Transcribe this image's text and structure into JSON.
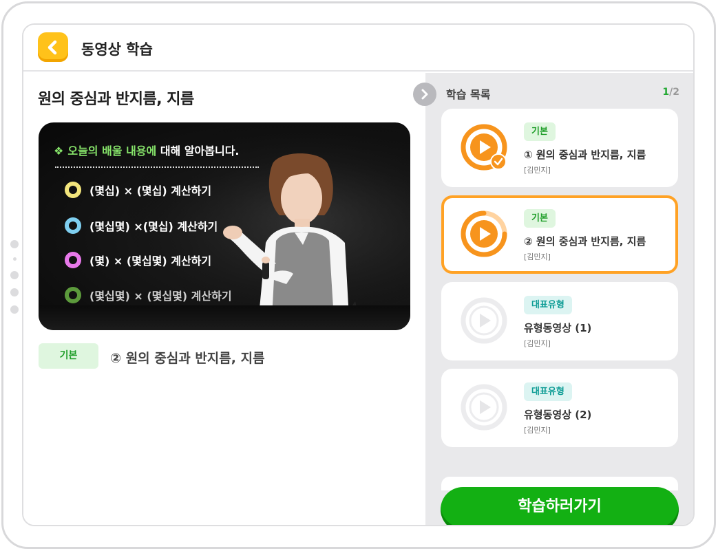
{
  "header": {
    "title": "동영상 학습"
  },
  "lesson": {
    "title": "원의 중심과 반지름, 지름"
  },
  "video": {
    "heading_prefix": "오늘의 배울 내용에",
    "heading_suffix": " 대해 알아봅니다.",
    "items": [
      {
        "text": "(몇십) ×  (몇십) 계산하기",
        "ring_color": "#f3e57c"
      },
      {
        "text": "(몇십몇) ×(몇십) 계산하기",
        "ring_color": "#7fcff0"
      },
      {
        "text": "(몇) × (몇십몇) 계산하기",
        "ring_color": "#e879ea"
      },
      {
        "text": "(몇십몇) × (몇십몇) 계산하기",
        "ring_color": "#5c9a3c"
      }
    ]
  },
  "current": {
    "tag": "기본",
    "title": "② 원의 중심과 반지름, 지름"
  },
  "sidebar": {
    "title": "학습 목록",
    "page_current": "1",
    "page_total": "/2",
    "cards": [
      {
        "tag": "기본",
        "title": "① 원의 중심과 반지름, 지름",
        "teacher": "[김민지]",
        "status": "completed"
      },
      {
        "tag": "기본",
        "title": "② 원의 중심과 반지름, 지름",
        "teacher": "[김민지]",
        "status": "active"
      },
      {
        "tag": "대표유형",
        "title": "유형동영상 (1)",
        "teacher": "[김민지]",
        "status": "pending"
      },
      {
        "tag": "대표유형",
        "title": "유형동영상 (2)",
        "teacher": "[김민지]",
        "status": "pending"
      }
    ],
    "go_button": "학습하러가기"
  },
  "colors": {
    "accent_green": "#13b013",
    "active_orange": "#ffa225",
    "back_yellow": "#ffc21a",
    "tag_green_bg": "#dff6df",
    "tag_teal_bg": "#dcf4f2"
  }
}
